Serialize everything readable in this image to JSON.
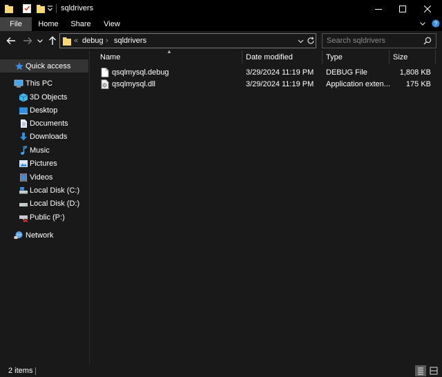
{
  "window": {
    "title": "sqldrivers",
    "minimize_glyph": "—",
    "maximize_glyph": "☐",
    "close_glyph": "✕"
  },
  "ribbon": {
    "tabs": [
      "File",
      "Home",
      "Share",
      "View"
    ],
    "active_tab": "File"
  },
  "address": {
    "overflow": "«",
    "segments": [
      "debug",
      "sqldrivers"
    ],
    "separator": "›"
  },
  "search": {
    "placeholder": "Search sqldrivers"
  },
  "sidebar": {
    "quick_access": "Quick access",
    "this_pc": "This PC",
    "items": [
      "3D Objects",
      "Desktop",
      "Documents",
      "Downloads",
      "Music",
      "Pictures",
      "Videos",
      "Local Disk (C:)",
      "Local Disk (D:)",
      "Public (P:)"
    ],
    "network": "Network"
  },
  "columns": {
    "name": "Name",
    "date": "Date modified",
    "type": "Type",
    "size": "Size"
  },
  "files": [
    {
      "name": "qsqlmysql.debug",
      "date": "3/29/2024 11:19 PM",
      "type": "DEBUG File",
      "size": "1,808 KB"
    },
    {
      "name": "qsqlmysql.dll",
      "date": "3/29/2024 11:19 PM",
      "type": "Application exten...",
      "size": "175 KB"
    }
  ],
  "status": {
    "item_count": "2 items"
  },
  "colors": {
    "background": "#191919",
    "titlebar": "#000000",
    "active_tab": "#414141",
    "selected_nav": "#333333",
    "folder_yellow": "#f8d775",
    "accent_blue": "#3a8ee6"
  },
  "icons": [
    "folder-icon",
    "properties-icon",
    "new-folder-icon",
    "back-arrow-icon",
    "forward-arrow-icon",
    "up-arrow-icon",
    "refresh-icon",
    "search-icon",
    "star-icon",
    "computer-icon",
    "cube-icon",
    "desktop-icon",
    "document-icon",
    "download-icon",
    "music-icon",
    "pictures-icon",
    "videos-icon",
    "drive-icon",
    "network-drive-icon",
    "network-icon",
    "file-icon",
    "dll-icon",
    "details-view-icon",
    "large-icons-view-icon"
  ]
}
